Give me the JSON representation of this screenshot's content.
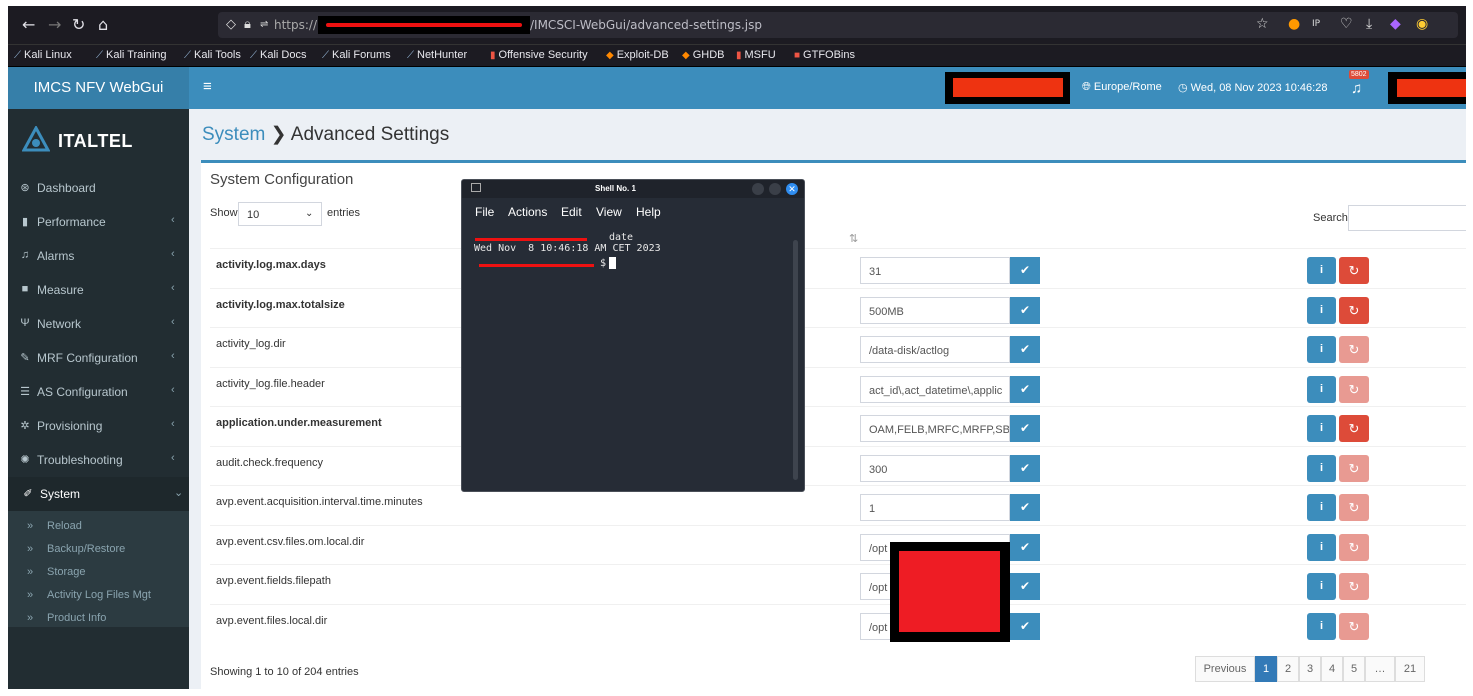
{
  "browser": {
    "scheme": "https://",
    "url_path": "/IMCSCI-WebGui/advanced-settings.jsp",
    "bookmarks": [
      "Kali Linux",
      "Kali Training",
      "Kali Tools",
      "Kali Docs",
      "Kali Forums",
      "NetHunter",
      "Offensive Security",
      "Exploit-DB",
      "GHDB",
      "MSFU",
      "GTFOBins"
    ]
  },
  "header": {
    "app_name": "IMCS NFV WebGui",
    "hamburger": "≡",
    "timezone": "Europe/Rome",
    "datetime": "Wed, 08 Nov 2023 10:46:28",
    "alarm_count": "5802"
  },
  "sidebar": {
    "brand": "ITALTEL",
    "items": [
      {
        "label": "Dashboard",
        "icon": "dashboard-icon",
        "glyph": "⊛"
      },
      {
        "label": "Performance",
        "icon": "bar-chart-icon",
        "glyph": "▮"
      },
      {
        "label": "Alarms",
        "icon": "bell-icon",
        "glyph": "♫"
      },
      {
        "label": "Measure",
        "icon": "hdd-icon",
        "glyph": "■"
      },
      {
        "label": "Network",
        "icon": "network-icon",
        "glyph": "Ψ"
      },
      {
        "label": "MRF Configuration",
        "icon": "edit-icon",
        "glyph": "✎"
      },
      {
        "label": "AS Configuration",
        "icon": "server-icon",
        "glyph": "☰"
      },
      {
        "label": "Provisioning",
        "icon": "cogs-icon",
        "glyph": "✲"
      },
      {
        "label": "Troubleshooting",
        "icon": "bug-icon",
        "glyph": "✺"
      },
      {
        "label": "System",
        "icon": "wrench-icon",
        "glyph": "✐"
      }
    ],
    "submenu": [
      "Reload",
      "Backup/Restore",
      "Storage",
      "Activity Log Files Mgt",
      "Product Info"
    ]
  },
  "page": {
    "crumb": "System",
    "separator": "❯",
    "title": "Advanced Settings"
  },
  "box": {
    "title": "System Configuration",
    "show_label": "Show",
    "length_value": "10",
    "entries_label": "entries",
    "search_label": "Search:",
    "showing": "Showing 1 to 10 of 204 entries"
  },
  "rows": [
    {
      "key": "activity.log.max.days",
      "value": "31",
      "bold": true,
      "sync_enabled": true
    },
    {
      "key": "activity.log.max.totalsize",
      "value": "500MB",
      "bold": true,
      "sync_enabled": true
    },
    {
      "key": "activity_log.dir",
      "value": "/data-disk/actlog",
      "bold": false,
      "sync_enabled": false
    },
    {
      "key": "activity_log.file.header",
      "value": "act_id\\,act_datetime\\,applic",
      "bold": false,
      "sync_enabled": false
    },
    {
      "key": "application.under.measurement",
      "value": "OAM,FELB,MRFC,MRFP,SBC",
      "bold": true,
      "sync_enabled": true
    },
    {
      "key": "audit.check.frequency",
      "value": "300",
      "bold": false,
      "sync_enabled": false
    },
    {
      "key": "avp.event.acquisition.interval.time.minutes",
      "value": "1",
      "bold": false,
      "sync_enabled": false
    },
    {
      "key": "avp.event.csv.files.om.local.dir",
      "value": "/opt",
      "bold": false,
      "sync_enabled": false
    },
    {
      "key": "avp.event.fields.filepath",
      "value": "/opt",
      "bold": false,
      "sync_enabled": false
    },
    {
      "key": "avp.event.files.local.dir",
      "value": "/opt",
      "bold": false,
      "sync_enabled": false
    }
  ],
  "pagination": [
    "Previous",
    "1",
    "2",
    "3",
    "4",
    "5",
    "…",
    "21"
  ],
  "terminal": {
    "title": "Shell No. 1",
    "menu": [
      "File",
      "Actions",
      "Edit",
      "View",
      "Help"
    ],
    "command": "date",
    "output": "Wed Nov  8 10:46:18 AM CET 2023",
    "prompt": "$"
  },
  "colors": {
    "primary": "#3c8dbc",
    "danger": "#dd4b39",
    "sidebar": "#222d32"
  }
}
